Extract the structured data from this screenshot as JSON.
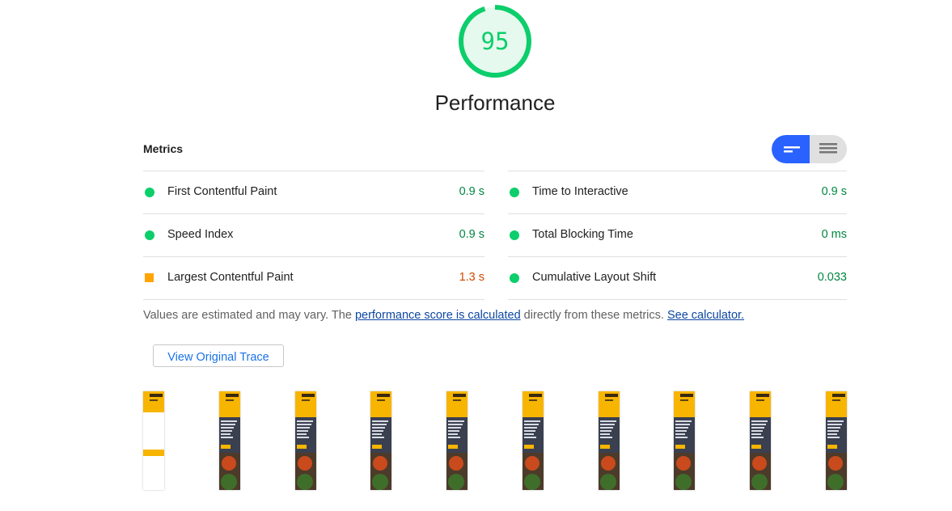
{
  "gauge": {
    "score": "95",
    "title": "Performance",
    "fraction": 0.95,
    "color": "#0cce6b"
  },
  "metrics": {
    "title": "Metrics",
    "left": [
      {
        "label": "First Contentful Paint",
        "value": "0.9 s",
        "status": "pass"
      },
      {
        "label": "Speed Index",
        "value": "0.9 s",
        "status": "pass"
      },
      {
        "label": "Largest Contentful Paint",
        "value": "1.3 s",
        "status": "average"
      }
    ],
    "right": [
      {
        "label": "Time to Interactive",
        "value": "0.9 s",
        "status": "pass"
      },
      {
        "label": "Total Blocking Time",
        "value": "0 ms",
        "status": "pass"
      },
      {
        "label": "Cumulative Layout Shift",
        "value": "0.033",
        "status": "pass"
      }
    ],
    "toggle": {
      "active": "compact-view-icon",
      "inactive": "list-view-icon"
    }
  },
  "note": {
    "prefix": "Values are estimated and may vary. The ",
    "link1": "performance score is calculated",
    "middle": " directly from these metrics. ",
    "link2": "See calculator."
  },
  "trace_button": "View Original Trace",
  "filmstrip": {
    "frame_count": 10
  },
  "colors": {
    "pass": "#0cce6b",
    "average": "#ffa400",
    "accent": "#2962ff"
  }
}
